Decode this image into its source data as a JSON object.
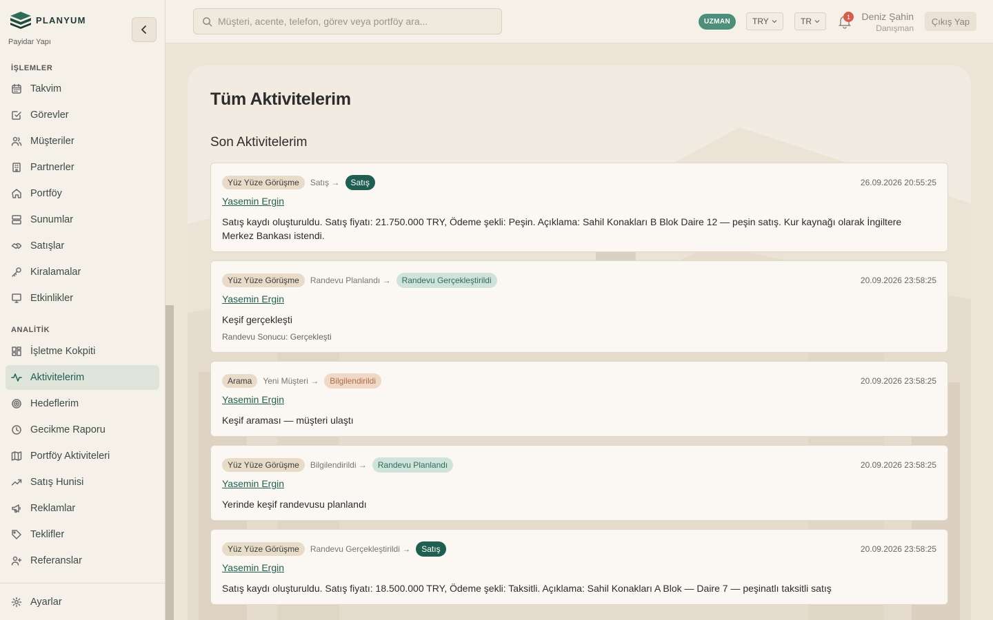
{
  "brand": {
    "name": "PLANYUM",
    "subtitle": "Payidar Yapı"
  },
  "sidebar": {
    "section_ops": "İŞLEMLER",
    "ops_items": [
      {
        "label": "Takvim",
        "icon": "calendar-icon"
      },
      {
        "label": "Görevler",
        "icon": "task-icon"
      },
      {
        "label": "Müşteriler",
        "icon": "users-icon"
      },
      {
        "label": "Partnerler",
        "icon": "building-icon"
      },
      {
        "label": "Portföy",
        "icon": "home-icon"
      },
      {
        "label": "Sunumlar",
        "icon": "presentation-icon"
      },
      {
        "label": "Satışlar",
        "icon": "handshake-icon"
      },
      {
        "label": "Kiralamalar",
        "icon": "key-icon"
      },
      {
        "label": "Etkinlikler",
        "icon": "monitor-icon"
      }
    ],
    "section_analytics": "ANALİTİK",
    "analytics_items": [
      {
        "label": "İşletme Kokpiti",
        "icon": "dashboard-icon"
      },
      {
        "label": "Aktivitelerim",
        "icon": "activity-icon"
      },
      {
        "label": "Hedeflerim",
        "icon": "target-icon"
      },
      {
        "label": "Gecikme Raporu",
        "icon": "clock-icon"
      },
      {
        "label": "Portföy Aktiviteleri",
        "icon": "map-icon"
      },
      {
        "label": "Satış Hunisi",
        "icon": "trend-icon"
      },
      {
        "label": "Reklamlar",
        "icon": "megaphone-icon"
      },
      {
        "label": "Teklifler",
        "icon": "tag-icon"
      },
      {
        "label": "Referanslar",
        "icon": "user-plus-icon"
      }
    ],
    "active_item": "Aktivitelerim",
    "settings": {
      "label": "Ayarlar",
      "icon": "gear-icon"
    }
  },
  "topbar": {
    "search_placeholder": "Müşteri, acente, telefon, görev veya portföy ara...",
    "role_badge": "UZMAN",
    "currency": "TRY",
    "language": "TR",
    "notification_count": "1",
    "user_name": "Deniz Şahin",
    "user_role": "Danışman",
    "logout_label": "Çıkış Yap"
  },
  "page": {
    "title": "Tüm Aktivitelerim",
    "section": "Son Aktivitelerim"
  },
  "activities": [
    {
      "type": "Yüz Yüze Görüşme",
      "from": "Satış →",
      "to": "Satış",
      "status_style": "dark",
      "date": "26.09.2026 20:55:25",
      "client": "Yasemin Ergin",
      "description": "Satış kaydı oluşturuldu. Satış fiyatı: 21.750.000 TRY, Ödeme şekli: Peşin. Açıklama: Sahil Konakları B Blok Daire 12 — peşin satış. Kur kaynağı olarak İngiltere Merkez Bankası istendi.",
      "note": ""
    },
    {
      "type": "Yüz Yüze Görüşme",
      "from": "Randevu Planlandı →",
      "to": "Randevu Gerçekleştirildi",
      "status_style": "mint",
      "date": "20.09.2026 23:58:25",
      "client": "Yasemin Ergin",
      "description": "Keşif gerçekleşti",
      "note": "Randevu Sonucu: Gerçekleşti"
    },
    {
      "type": "Arama",
      "from": "Yeni Müşteri →",
      "to": "Bilgilendirildi",
      "status_style": "peach",
      "date": "20.09.2026 23:58:25",
      "client": "Yasemin Ergin",
      "description": "Keşif araması — müşteri ulaştı",
      "note": ""
    },
    {
      "type": "Yüz Yüze Görüşme",
      "from": "Bilgilendirildi →",
      "to": "Randevu Planlandı",
      "status_style": "mint",
      "date": "20.09.2026 23:58:25",
      "client": "Yasemin Ergin",
      "description": "Yerinde keşif randevusu planlandı",
      "note": ""
    },
    {
      "type": "Yüz Yüze Görüşme",
      "from": "Randevu Gerçekleştirildi →",
      "to": "Satış",
      "status_style": "dark",
      "date": "20.09.2026 23:58:25",
      "client": "Yasemin Ergin",
      "description": "Satış kaydı oluşturuldu. Satış fiyatı: 18.500.000 TRY, Ödeme şekli: Taksitli. Açıklama: Sahil Konakları A Blok — Daire 7 — peşinatlı taksitli satış",
      "note": ""
    }
  ],
  "colors": {
    "accent": "#1f5e50",
    "background": "#ede5d8",
    "sidebar": "#f6f1e8",
    "active_bg": "#dfe4db"
  }
}
